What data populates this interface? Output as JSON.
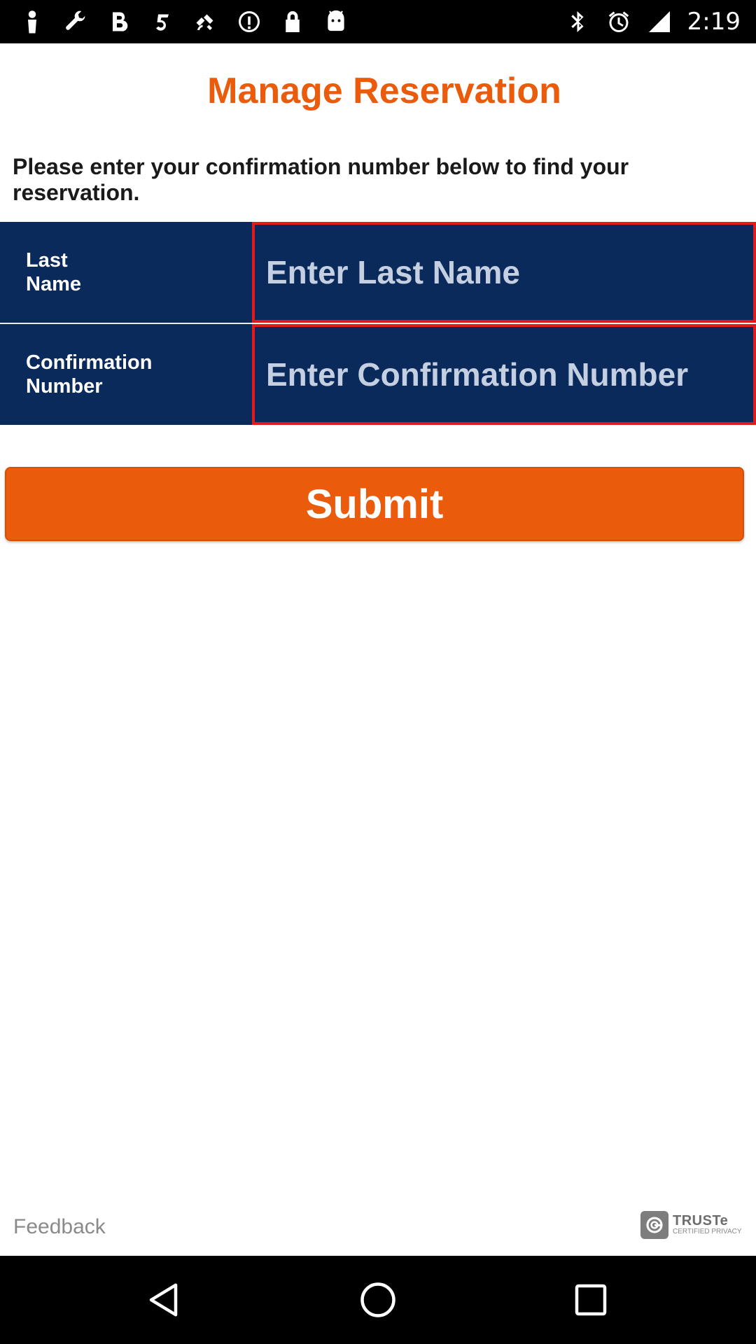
{
  "status_bar": {
    "time": "2:19",
    "left_icons": [
      "person-icon",
      "wrench-icon",
      "bold-b-icon",
      "five-icon",
      "fake-gps-icon",
      "info-circle-icon",
      "lock-icon",
      "android-icon"
    ],
    "right_icons": [
      "bluetooth-icon",
      "alarm-icon",
      "signal-icon"
    ]
  },
  "page": {
    "title": "Manage Reservation",
    "intro": "Please enter your confirmation number below to find your reservation."
  },
  "form": {
    "last_name": {
      "label": "Last Name",
      "placeholder": "Enter Last Name",
      "value": ""
    },
    "confirmation": {
      "label": "Confirmation Number",
      "placeholder": "Enter Confirmation Number",
      "value": ""
    },
    "submit_label": "Submit"
  },
  "footer": {
    "feedback_label": "Feedback",
    "truste_name": "TRUSTe",
    "truste_sub": "CERTIFIED PRIVACY"
  },
  "colors": {
    "accent_orange": "#ea5b0c",
    "form_navy": "#0b2a5c",
    "field_border_red": "#e11b1b"
  },
  "nav_bar": {
    "buttons": [
      "back-icon",
      "home-icon",
      "recent-apps-icon"
    ]
  }
}
